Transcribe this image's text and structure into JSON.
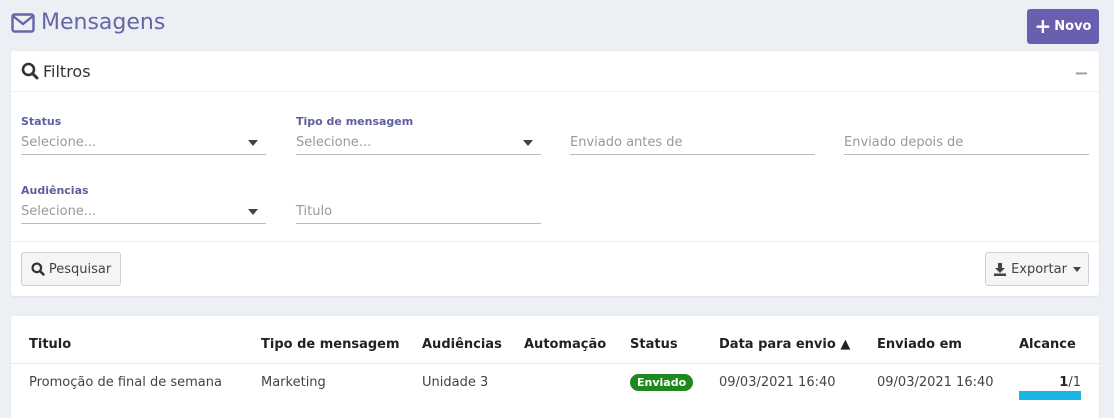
{
  "header": {
    "title": "Mensagens",
    "new_button": "Novo",
    "new_plus": "+"
  },
  "filters": {
    "title": "Filtros",
    "collapse": "−",
    "status_label": "Status",
    "status_placeholder": "Selecione...",
    "type_label": "Tipo de mensagem",
    "type_placeholder": "Selecione...",
    "sent_before": "Enviado antes de",
    "sent_after": "Enviado depois de",
    "audiences_label": "Audiências",
    "audiences_placeholder": "Selecione...",
    "title_field": "Titulo",
    "search_button": "Pesquisar",
    "export_button": "Exportar"
  },
  "table": {
    "columns": [
      "Titulo",
      "Tipo de mensagem",
      "Audiências",
      "Automação",
      "Status",
      "Data para envio ▲",
      "Enviado em",
      "Alcance"
    ],
    "rows": [
      {
        "title": "Promoção de final de semana",
        "type": "Marketing",
        "audience": "Unidade 3",
        "automation": "",
        "status": "Enviado",
        "send_date": "09/03/2021 16:40",
        "sent_at": "09/03/2021 16:40",
        "reach_done": "1",
        "reach_total": "/1",
        "reach_fraction": 1.0
      }
    ]
  },
  "colors": {
    "accent": "#6a5fae",
    "title": "#6466a6",
    "status_sent": "#1e8a1e",
    "reach_bar": "#19b6e4"
  }
}
